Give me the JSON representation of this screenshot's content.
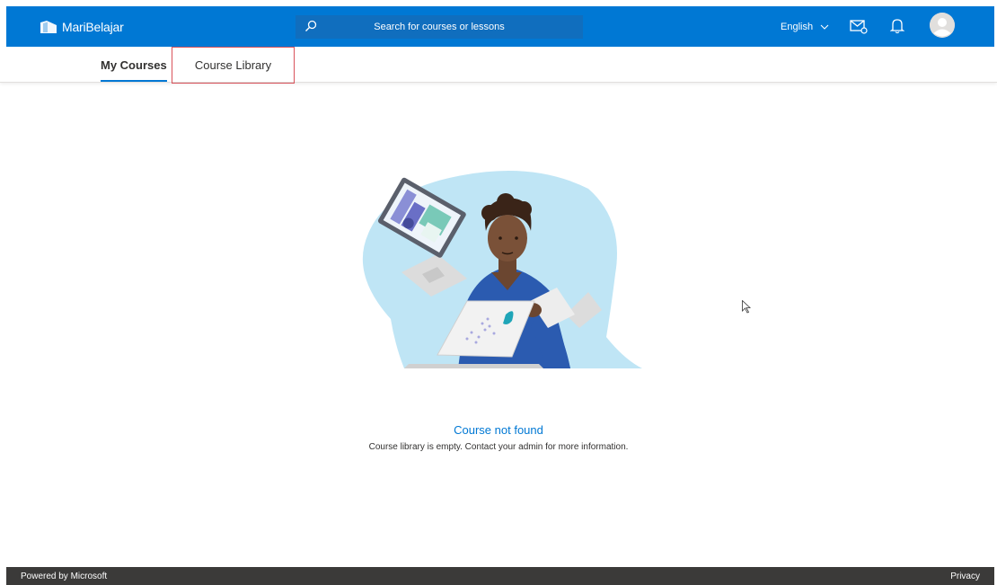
{
  "header": {
    "brand_name": "MariBelajar",
    "search_placeholder": "Search for courses or lessons",
    "language": "English"
  },
  "tabs": [
    {
      "label": "My Courses",
      "active": true
    },
    {
      "label": "Course Library",
      "active": false
    }
  ],
  "empty_state": {
    "title": "Course not found",
    "message": "Course library is empty. Contact your admin for more information."
  },
  "footer": {
    "powered_by": "Powered by Microsoft",
    "privacy": "Privacy"
  },
  "icons": {
    "search": "search-icon",
    "chevron": "chevron-down-icon",
    "mail": "mail-settings-icon",
    "bell": "bell-icon",
    "avatar": "user-avatar-icon"
  },
  "colors": {
    "brand_blue": "#0078d4",
    "footer_bg": "#3b3a39",
    "highlight_border": "#d9535b"
  }
}
